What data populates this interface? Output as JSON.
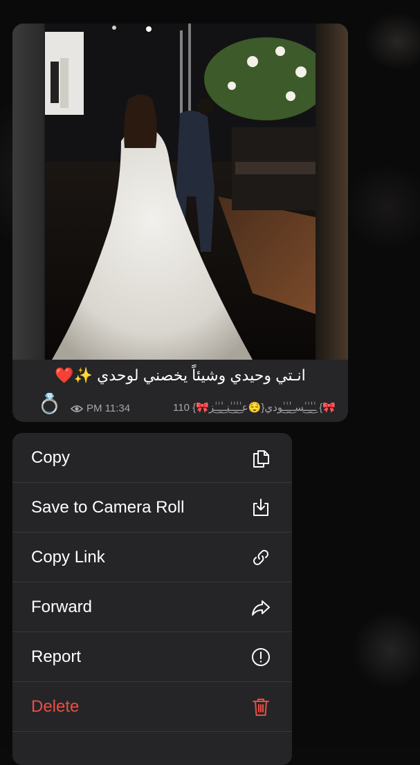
{
  "message": {
    "caption": "انـتي وحيدي وشيئاً يخصني لوحدي ✨❤️",
    "reactions_count": "110",
    "author_signature": "{🎀عـٰ͜ـٰٰـٰ͜ـٰنـ͜ـٰٰـٰ͜ـٰز😌}ـٰ͜ـٰٰـٰ͜ـٰسـ͜ـٰٰـٰ͜ـٰودي {🎀",
    "time": "PM 11:34",
    "ring_emoji": "💍"
  },
  "context_menu": {
    "items": [
      {
        "label": "Copy",
        "icon": "copy-icon"
      },
      {
        "label": "Save to Camera Roll",
        "icon": "save-icon"
      },
      {
        "label": "Copy Link",
        "icon": "link-icon"
      },
      {
        "label": "Forward",
        "icon": "forward-icon"
      },
      {
        "label": "Report",
        "icon": "report-icon"
      },
      {
        "label": "Delete",
        "icon": "trash-icon"
      }
    ],
    "danger_color": "#ec4d44"
  }
}
